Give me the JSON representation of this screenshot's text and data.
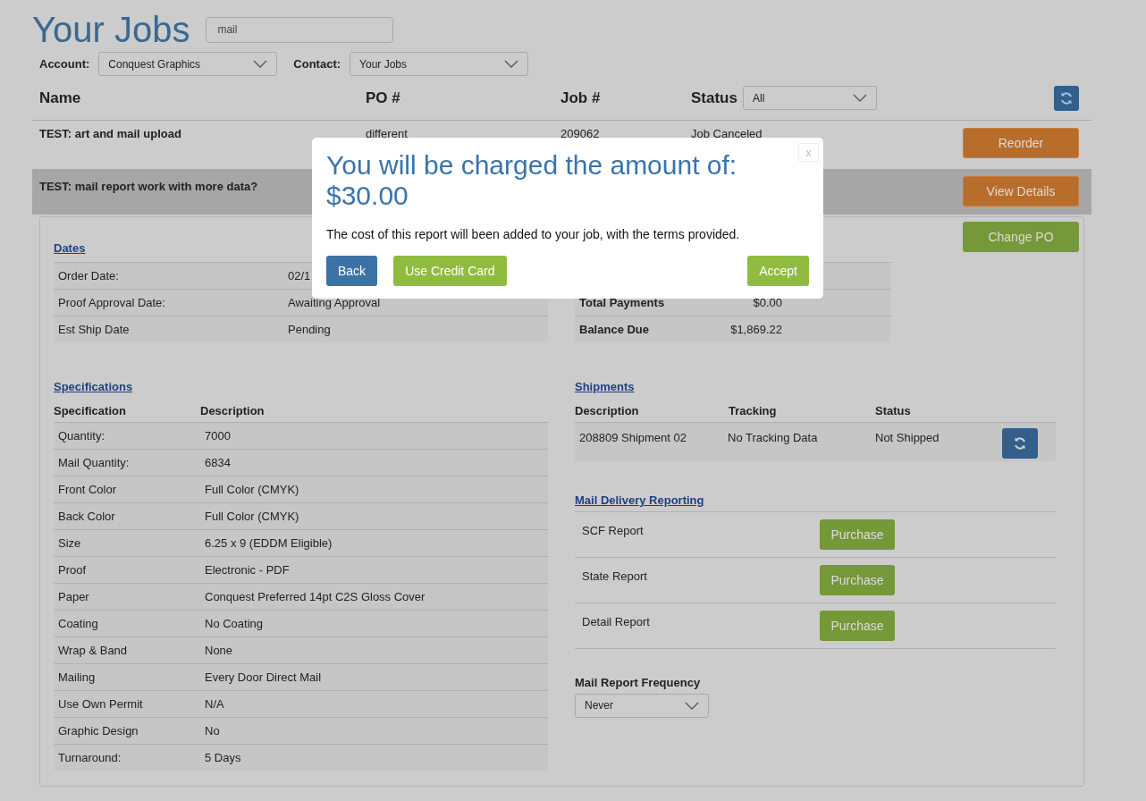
{
  "page": {
    "title": "Your Jobs",
    "search": {
      "value": "mail"
    }
  },
  "filters": [
    {
      "label": "Account:",
      "value": "Conquest Graphics"
    },
    {
      "label": "Contact:",
      "value": "Your Jobs"
    }
  ],
  "jobs_table": {
    "columns": [
      "Name",
      "PO #",
      "Job #",
      "Status"
    ],
    "status_filter": "All",
    "rows": [
      {
        "name": "TEST: art and mail upload",
        "po": "different",
        "job": "209062",
        "status": "Job Canceled",
        "action": "Reorder",
        "selected": false
      },
      {
        "name": "TEST: mail report work with more data?",
        "action": "View Details",
        "selected": true
      }
    ]
  },
  "details": {
    "change_po": "Change PO",
    "dates": {
      "title": "Dates",
      "rows": [
        {
          "label": "Order Date:",
          "value": "02/1"
        },
        {
          "label": "Proof Approval Date:",
          "value": "Awaiting Approval"
        },
        {
          "label": "Est Ship Date",
          "value": "Pending"
        }
      ]
    },
    "costs": {
      "rows": [
        {
          "label": "Total Payments",
          "value": "$0.00"
        },
        {
          "label": "Balance Due",
          "value": "$1,869.22"
        }
      ]
    },
    "specifications": {
      "title": "Specifications",
      "columns": [
        "Specification",
        "Description"
      ],
      "rows": [
        {
          "label": "Quantity:",
          "value": "7000"
        },
        {
          "label": "Mail Quantity:",
          "value": "6834"
        },
        {
          "label": "Front Color",
          "value": "Full Color (CMYK)"
        },
        {
          "label": "Back Color",
          "value": "Full Color (CMYK)"
        },
        {
          "label": "Size",
          "value": "6.25 x 9 (EDDM Eligible)"
        },
        {
          "label": "Proof",
          "value": "Electronic - PDF"
        },
        {
          "label": "Paper",
          "value": "Conquest Preferred 14pt C2S Gloss Cover"
        },
        {
          "label": "Coating",
          "value": "No Coating"
        },
        {
          "label": "Wrap & Band",
          "value": "None"
        },
        {
          "label": "Mailing",
          "value": "Every Door Direct Mail"
        },
        {
          "label": "Use Own Permit",
          "value": "N/A"
        },
        {
          "label": "Graphic Design",
          "value": "No"
        },
        {
          "label": "Turnaround:",
          "value": "5 Days"
        }
      ]
    },
    "shipments": {
      "title": "Shipments",
      "columns": [
        "Description",
        "Tracking",
        "Status"
      ],
      "rows": [
        {
          "description": "208809 Shipment 02",
          "tracking": "No Tracking Data",
          "status": "Not Shipped"
        }
      ]
    },
    "mail_reporting": {
      "title": "Mail Delivery Reporting",
      "rows": [
        {
          "label": "SCF Report",
          "action": "Purchase"
        },
        {
          "label": "State Report",
          "action": "Purchase"
        },
        {
          "label": "Detail Report",
          "action": "Purchase"
        }
      ]
    },
    "frequency": {
      "label": "Mail Report Frequency",
      "value": "Never"
    }
  },
  "dialog": {
    "title": "You will be charged the amount of: $30.00",
    "message": "The cost of this report will been added to your job, with the terms provided.",
    "close": "x",
    "buttons": [
      {
        "label": "Back",
        "kind": "secondary"
      },
      {
        "label": "Use Credit Card",
        "kind": "primary"
      },
      {
        "label": "Accept",
        "kind": "primary"
      }
    ]
  }
}
